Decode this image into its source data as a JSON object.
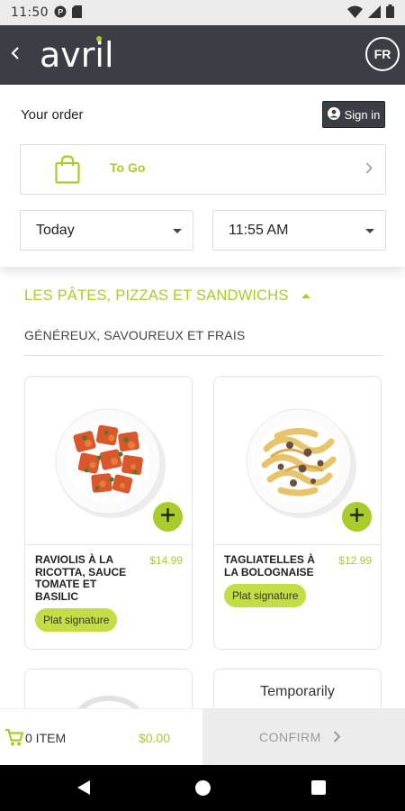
{
  "status_bar": {
    "time": "11:50"
  },
  "header": {
    "logo_text": "avril",
    "lang_label": "FR"
  },
  "order": {
    "title": "Your order",
    "sign_in_label": "Sign in",
    "mode_label": "To Go",
    "day_value": "Today",
    "time_value": "11:55 AM"
  },
  "section": {
    "title": "LES PÂTES, PIZZAS ET SANDWICHS",
    "subtitle": "GÉNÉREUX, SAVOUREUX ET FRAIS"
  },
  "products": [
    {
      "name": "RAVIOLIS À LA RICOTTA, SAUCE TOMATE ET BASILIC",
      "price": "$14.99",
      "tag": "Plat signature"
    },
    {
      "name": "TAGLIATELLES À LA BOLOGNAISE",
      "price": "$12.99",
      "tag": "Plat signature"
    },
    {
      "status": "Temporarily"
    }
  ],
  "cart": {
    "count_label": "0 ITEM",
    "total": "$0.00",
    "confirm_label": "CONFIRM"
  },
  "colors": {
    "accent": "#a9cc2b",
    "header_bg": "#3b3e45",
    "tag_bg": "#c3dd44"
  }
}
